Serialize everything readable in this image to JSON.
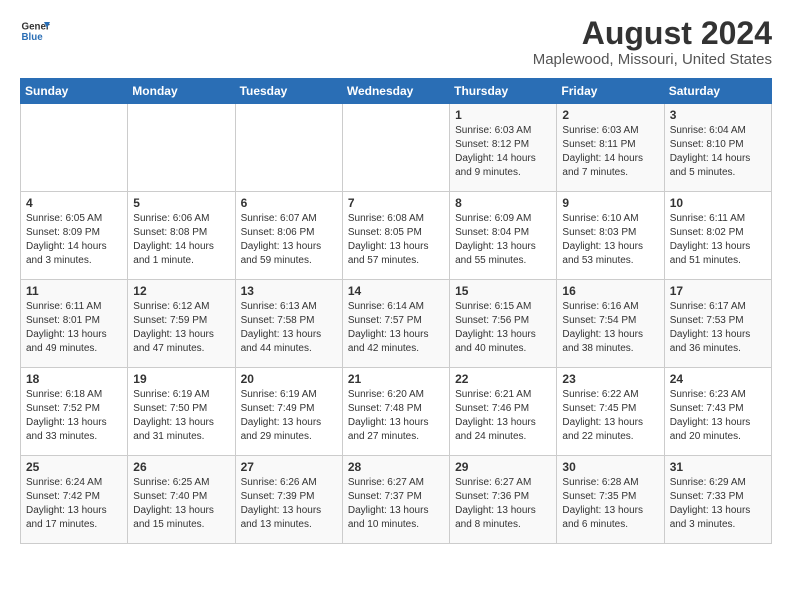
{
  "logo": {
    "line1": "General",
    "line2": "Blue"
  },
  "title": "August 2024",
  "subtitle": "Maplewood, Missouri, United States",
  "days_of_week": [
    "Sunday",
    "Monday",
    "Tuesday",
    "Wednesday",
    "Thursday",
    "Friday",
    "Saturday"
  ],
  "weeks": [
    [
      {
        "day": "",
        "info": ""
      },
      {
        "day": "",
        "info": ""
      },
      {
        "day": "",
        "info": ""
      },
      {
        "day": "",
        "info": ""
      },
      {
        "day": "1",
        "info": "Sunrise: 6:03 AM\nSunset: 8:12 PM\nDaylight: 14 hours\nand 9 minutes."
      },
      {
        "day": "2",
        "info": "Sunrise: 6:03 AM\nSunset: 8:11 PM\nDaylight: 14 hours\nand 7 minutes."
      },
      {
        "day": "3",
        "info": "Sunrise: 6:04 AM\nSunset: 8:10 PM\nDaylight: 14 hours\nand 5 minutes."
      }
    ],
    [
      {
        "day": "4",
        "info": "Sunrise: 6:05 AM\nSunset: 8:09 PM\nDaylight: 14 hours\nand 3 minutes."
      },
      {
        "day": "5",
        "info": "Sunrise: 6:06 AM\nSunset: 8:08 PM\nDaylight: 14 hours\nand 1 minute."
      },
      {
        "day": "6",
        "info": "Sunrise: 6:07 AM\nSunset: 8:06 PM\nDaylight: 13 hours\nand 59 minutes."
      },
      {
        "day": "7",
        "info": "Sunrise: 6:08 AM\nSunset: 8:05 PM\nDaylight: 13 hours\nand 57 minutes."
      },
      {
        "day": "8",
        "info": "Sunrise: 6:09 AM\nSunset: 8:04 PM\nDaylight: 13 hours\nand 55 minutes."
      },
      {
        "day": "9",
        "info": "Sunrise: 6:10 AM\nSunset: 8:03 PM\nDaylight: 13 hours\nand 53 minutes."
      },
      {
        "day": "10",
        "info": "Sunrise: 6:11 AM\nSunset: 8:02 PM\nDaylight: 13 hours\nand 51 minutes."
      }
    ],
    [
      {
        "day": "11",
        "info": "Sunrise: 6:11 AM\nSunset: 8:01 PM\nDaylight: 13 hours\nand 49 minutes."
      },
      {
        "day": "12",
        "info": "Sunrise: 6:12 AM\nSunset: 7:59 PM\nDaylight: 13 hours\nand 47 minutes."
      },
      {
        "day": "13",
        "info": "Sunrise: 6:13 AM\nSunset: 7:58 PM\nDaylight: 13 hours\nand 44 minutes."
      },
      {
        "day": "14",
        "info": "Sunrise: 6:14 AM\nSunset: 7:57 PM\nDaylight: 13 hours\nand 42 minutes."
      },
      {
        "day": "15",
        "info": "Sunrise: 6:15 AM\nSunset: 7:56 PM\nDaylight: 13 hours\nand 40 minutes."
      },
      {
        "day": "16",
        "info": "Sunrise: 6:16 AM\nSunset: 7:54 PM\nDaylight: 13 hours\nand 38 minutes."
      },
      {
        "day": "17",
        "info": "Sunrise: 6:17 AM\nSunset: 7:53 PM\nDaylight: 13 hours\nand 36 minutes."
      }
    ],
    [
      {
        "day": "18",
        "info": "Sunrise: 6:18 AM\nSunset: 7:52 PM\nDaylight: 13 hours\nand 33 minutes."
      },
      {
        "day": "19",
        "info": "Sunrise: 6:19 AM\nSunset: 7:50 PM\nDaylight: 13 hours\nand 31 minutes."
      },
      {
        "day": "20",
        "info": "Sunrise: 6:19 AM\nSunset: 7:49 PM\nDaylight: 13 hours\nand 29 minutes."
      },
      {
        "day": "21",
        "info": "Sunrise: 6:20 AM\nSunset: 7:48 PM\nDaylight: 13 hours\nand 27 minutes."
      },
      {
        "day": "22",
        "info": "Sunrise: 6:21 AM\nSunset: 7:46 PM\nDaylight: 13 hours\nand 24 minutes."
      },
      {
        "day": "23",
        "info": "Sunrise: 6:22 AM\nSunset: 7:45 PM\nDaylight: 13 hours\nand 22 minutes."
      },
      {
        "day": "24",
        "info": "Sunrise: 6:23 AM\nSunset: 7:43 PM\nDaylight: 13 hours\nand 20 minutes."
      }
    ],
    [
      {
        "day": "25",
        "info": "Sunrise: 6:24 AM\nSunset: 7:42 PM\nDaylight: 13 hours\nand 17 minutes."
      },
      {
        "day": "26",
        "info": "Sunrise: 6:25 AM\nSunset: 7:40 PM\nDaylight: 13 hours\nand 15 minutes."
      },
      {
        "day": "27",
        "info": "Sunrise: 6:26 AM\nSunset: 7:39 PM\nDaylight: 13 hours\nand 13 minutes."
      },
      {
        "day": "28",
        "info": "Sunrise: 6:27 AM\nSunset: 7:37 PM\nDaylight: 13 hours\nand 10 minutes."
      },
      {
        "day": "29",
        "info": "Sunrise: 6:27 AM\nSunset: 7:36 PM\nDaylight: 13 hours\nand 8 minutes."
      },
      {
        "day": "30",
        "info": "Sunrise: 6:28 AM\nSunset: 7:35 PM\nDaylight: 13 hours\nand 6 minutes."
      },
      {
        "day": "31",
        "info": "Sunrise: 6:29 AM\nSunset: 7:33 PM\nDaylight: 13 hours\nand 3 minutes."
      }
    ]
  ]
}
